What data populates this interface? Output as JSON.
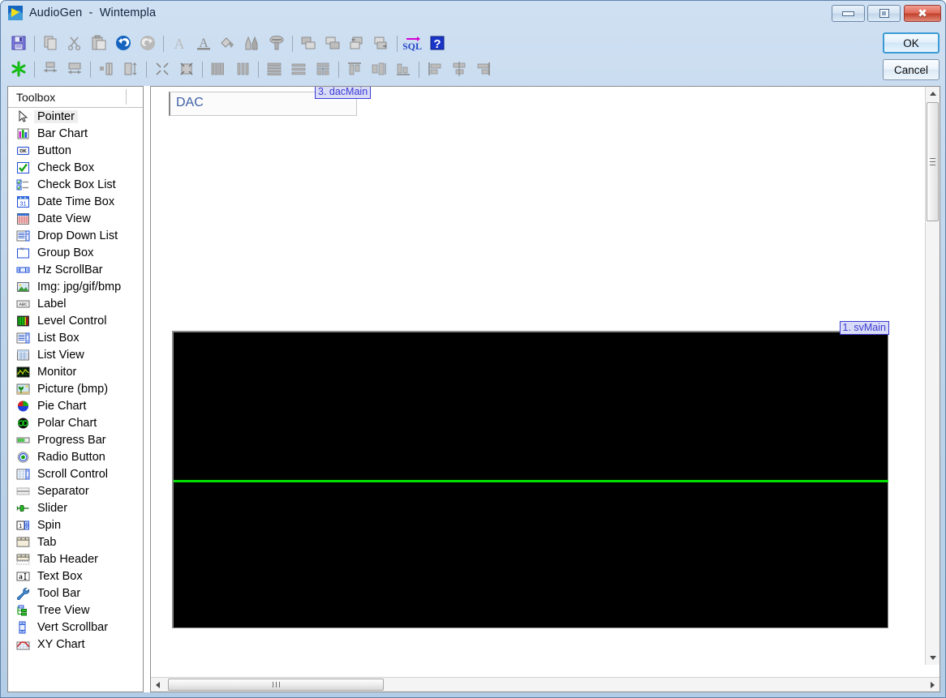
{
  "window": {
    "app_icon": "audiogen-logo-icon",
    "title": "AudioGen  -  Wintempla",
    "controls": {
      "minimize": "minimize-icon",
      "maximize": "restore-icon",
      "close": "close-icon"
    }
  },
  "dialog_buttons": {
    "ok_label": "OK",
    "cancel_label": "Cancel"
  },
  "toolbar": {
    "row1": [
      {
        "name": "save-icon",
        "kind": "save"
      },
      {
        "kind": "sep"
      },
      {
        "name": "copy-icon",
        "kind": "copy"
      },
      {
        "name": "cut-icon",
        "kind": "cut"
      },
      {
        "name": "paste-icon",
        "kind": "paste"
      },
      {
        "name": "undo-icon",
        "kind": "undo"
      },
      {
        "name": "redo-icon",
        "kind": "redo"
      },
      {
        "kind": "sep"
      },
      {
        "name": "font-icon",
        "kind": "font-a"
      },
      {
        "name": "font-color-icon",
        "kind": "font-a-underline"
      },
      {
        "name": "fill-color-icon",
        "kind": "diamond"
      },
      {
        "name": "pen-icon",
        "kind": "pens"
      },
      {
        "name": "screw-icon",
        "kind": "screw"
      },
      {
        "kind": "sep"
      },
      {
        "name": "bring-to-front-icon",
        "kind": "layer1"
      },
      {
        "name": "send-to-back-icon",
        "kind": "layer2"
      },
      {
        "name": "bring-forward-icon",
        "kind": "layer3"
      },
      {
        "name": "send-backward-icon",
        "kind": "layer4"
      },
      {
        "kind": "sep"
      },
      {
        "name": "sql-icon",
        "kind": "sql"
      },
      {
        "name": "help-icon",
        "kind": "help"
      }
    ],
    "row2": [
      {
        "name": "snowflake-icon",
        "kind": "snowflake"
      },
      {
        "kind": "sep"
      },
      {
        "name": "size-width-icon",
        "kind": "size-w"
      },
      {
        "name": "size-height-icon",
        "kind": "size-h"
      },
      {
        "kind": "sep"
      },
      {
        "name": "spacing-vertical-icon",
        "kind": "spc-v"
      },
      {
        "name": "spacing-horizontal-icon",
        "kind": "spc-h"
      },
      {
        "kind": "sep"
      },
      {
        "name": "shrink-icon",
        "kind": "shrink"
      },
      {
        "name": "collapse-icon",
        "kind": "collapse"
      },
      {
        "kind": "sep"
      },
      {
        "name": "columns-equal-icon",
        "kind": "cols1"
      },
      {
        "name": "columns-icon",
        "kind": "cols2"
      },
      {
        "kind": "sep"
      },
      {
        "name": "rows-fill-icon",
        "kind": "rows1"
      },
      {
        "name": "rows-spaced-icon",
        "kind": "rows2"
      },
      {
        "name": "grid-expand-icon",
        "kind": "gridexp"
      },
      {
        "kind": "sep"
      },
      {
        "name": "align-top-icon",
        "kind": "align-top"
      },
      {
        "name": "align-middle-icon",
        "kind": "align-mid"
      },
      {
        "name": "align-bottom-icon",
        "kind": "align-bot"
      },
      {
        "kind": "sep"
      },
      {
        "name": "align-left-icon",
        "kind": "align-left"
      },
      {
        "name": "align-center-icon",
        "kind": "align-center"
      },
      {
        "name": "align-right-icon",
        "kind": "align-right"
      }
    ]
  },
  "toolbox": {
    "title": "Toolbox",
    "selected_index": 0,
    "items": [
      {
        "label": "Pointer",
        "icon": "pointer-icon"
      },
      {
        "label": "Bar Chart",
        "icon": "bar-chart-icon"
      },
      {
        "label": "Button",
        "icon": "button-icon"
      },
      {
        "label": "Check Box",
        "icon": "check-box-icon"
      },
      {
        "label": "Check Box List",
        "icon": "check-box-list-icon"
      },
      {
        "label": "Date Time Box",
        "icon": "date-time-box-icon"
      },
      {
        "label": "Date View",
        "icon": "date-view-icon"
      },
      {
        "label": "Drop Down List",
        "icon": "drop-down-list-icon"
      },
      {
        "label": "Group Box",
        "icon": "group-box-icon"
      },
      {
        "label": "Hz ScrollBar",
        "icon": "horizontal-scrollbar-icon"
      },
      {
        "label": "Img: jpg/gif/bmp",
        "icon": "image-icon"
      },
      {
        "label": "Label",
        "icon": "label-icon"
      },
      {
        "label": "Level Control",
        "icon": "level-control-icon"
      },
      {
        "label": "List Box",
        "icon": "list-box-icon"
      },
      {
        "label": "List View",
        "icon": "list-view-icon"
      },
      {
        "label": "Monitor",
        "icon": "monitor-icon"
      },
      {
        "label": "Picture (bmp)",
        "icon": "picture-icon"
      },
      {
        "label": "Pie Chart",
        "icon": "pie-chart-icon"
      },
      {
        "label": "Polar Chart",
        "icon": "polar-chart-icon"
      },
      {
        "label": "Progress Bar",
        "icon": "progress-bar-icon"
      },
      {
        "label": "Radio Button",
        "icon": "radio-button-icon"
      },
      {
        "label": "Scroll Control",
        "icon": "scroll-control-icon"
      },
      {
        "label": "Separator",
        "icon": "separator-icon"
      },
      {
        "label": "Slider",
        "icon": "slider-icon"
      },
      {
        "label": "Spin",
        "icon": "spin-icon"
      },
      {
        "label": "Tab",
        "icon": "tab-icon"
      },
      {
        "label": "Tab Header",
        "icon": "tab-header-icon"
      },
      {
        "label": "Text Box",
        "icon": "text-box-icon"
      },
      {
        "label": "Tool Bar",
        "icon": "tool-bar-icon"
      },
      {
        "label": "Tree View",
        "icon": "tree-view-icon"
      },
      {
        "label": "Vert Scrollbar",
        "icon": "vertical-scrollbar-icon"
      },
      {
        "label": "XY Chart",
        "icon": "xy-chart-icon"
      }
    ]
  },
  "canvas": {
    "controls": [
      {
        "name": "dac-control",
        "text": "DAC",
        "badge": "3. dacMain",
        "text_color": "#3e5ea8"
      },
      {
        "name": "scope-control",
        "badge": "1. svMain",
        "background": "#000000",
        "waveform_color": "#00e000"
      }
    ]
  },
  "scrollbars": {
    "vertical": {
      "up": "scroll-up-icon",
      "down": "scroll-down-icon",
      "grip": "grip-icon"
    },
    "horizontal": {
      "left": "scroll-left-icon",
      "right": "scroll-right-icon",
      "grip": "grip-icon"
    }
  }
}
